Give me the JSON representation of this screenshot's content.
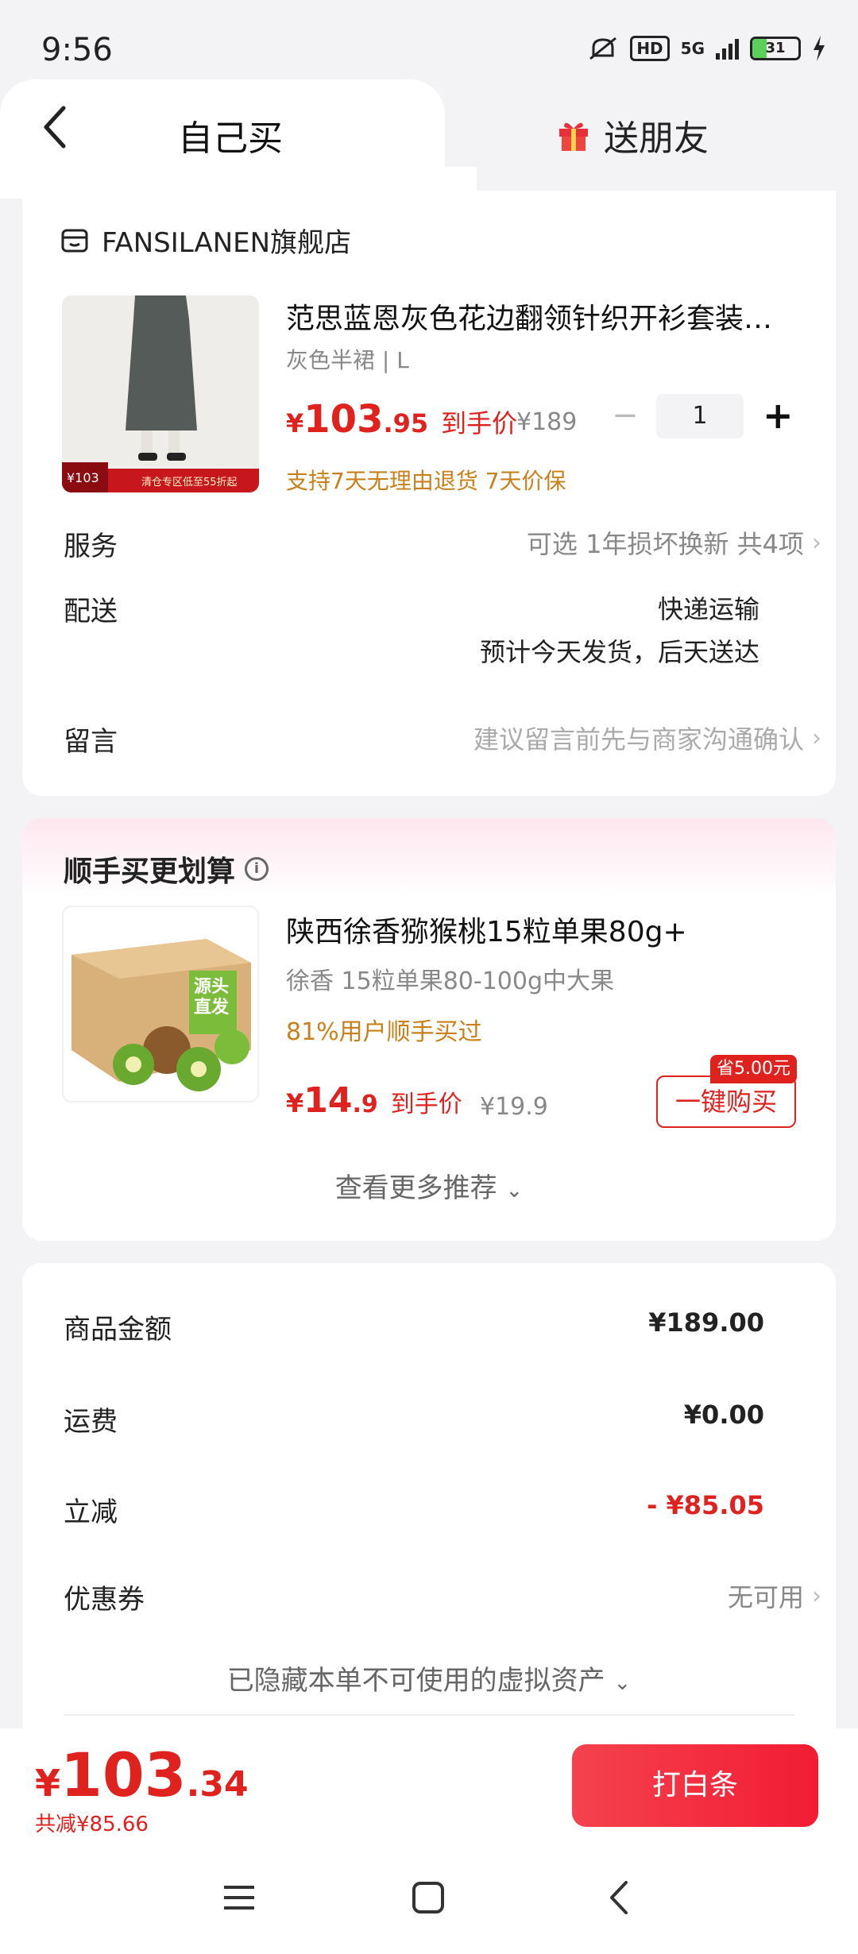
{
  "status": {
    "time": "9:56",
    "hd": "HD",
    "network": "5G",
    "battery": "31"
  },
  "tabs": {
    "self": "自己买",
    "gift": "送朋友"
  },
  "store": {
    "name": "FANSILANEN旗舰店"
  },
  "product": {
    "title": "范思蓝恩灰色花边翻领针织开衫套装女…",
    "sku": "灰色半裙 | L",
    "price_currency": "¥",
    "price_int": "103",
    "price_dec": ".95",
    "price_tag": "到手价",
    "orig_price": "¥189",
    "qty": "1",
    "guarantee": "支持7天无理由退货  7天价保",
    "img_badge_price": "¥103",
    "img_badge_text": "清仓专区低至55折起"
  },
  "service": {
    "label": "服务",
    "value": "可选 1年损坏换新 共4项"
  },
  "delivery": {
    "label": "配送",
    "method": "快递运输",
    "eta": "预计今天发货，后天送达"
  },
  "message": {
    "label": "留言",
    "placeholder": "建议留言前先与商家沟通确认"
  },
  "recommend": {
    "title": "顺手买更划算",
    "item": {
      "name": "陕西徐香猕猴桃15粒单果80g+",
      "sub": "徐香 15粒单果80-100g中大果",
      "pct": "81%用户顺手买过",
      "price_currency": "¥",
      "price_int": "14",
      "price_dec": ".9",
      "price_tag": "到手价",
      "orig_price": "¥19.9",
      "buy_label": "一键购买",
      "save_badge": "省5.00元",
      "box_text": "源头直发"
    },
    "more": "查看更多推荐"
  },
  "summary": {
    "goods_label": "商品金额",
    "goods_value": "¥189.00",
    "ship_label": "运费",
    "ship_value": "¥0.00",
    "discount_label": "立减",
    "discount_value": "- ¥85.05",
    "coupon_label": "优惠券",
    "coupon_value": "无可用",
    "hidden": "已隐藏本单不可使用的虚拟资产"
  },
  "footer": {
    "currency": "¥",
    "total_int": "103",
    "total_dec": ".34",
    "saved": "共减¥85.66",
    "pay_label": "打白条"
  },
  "colors": {
    "accent": "#e0221f",
    "orange": "#c8801a",
    "battery": "#5bd05b"
  }
}
